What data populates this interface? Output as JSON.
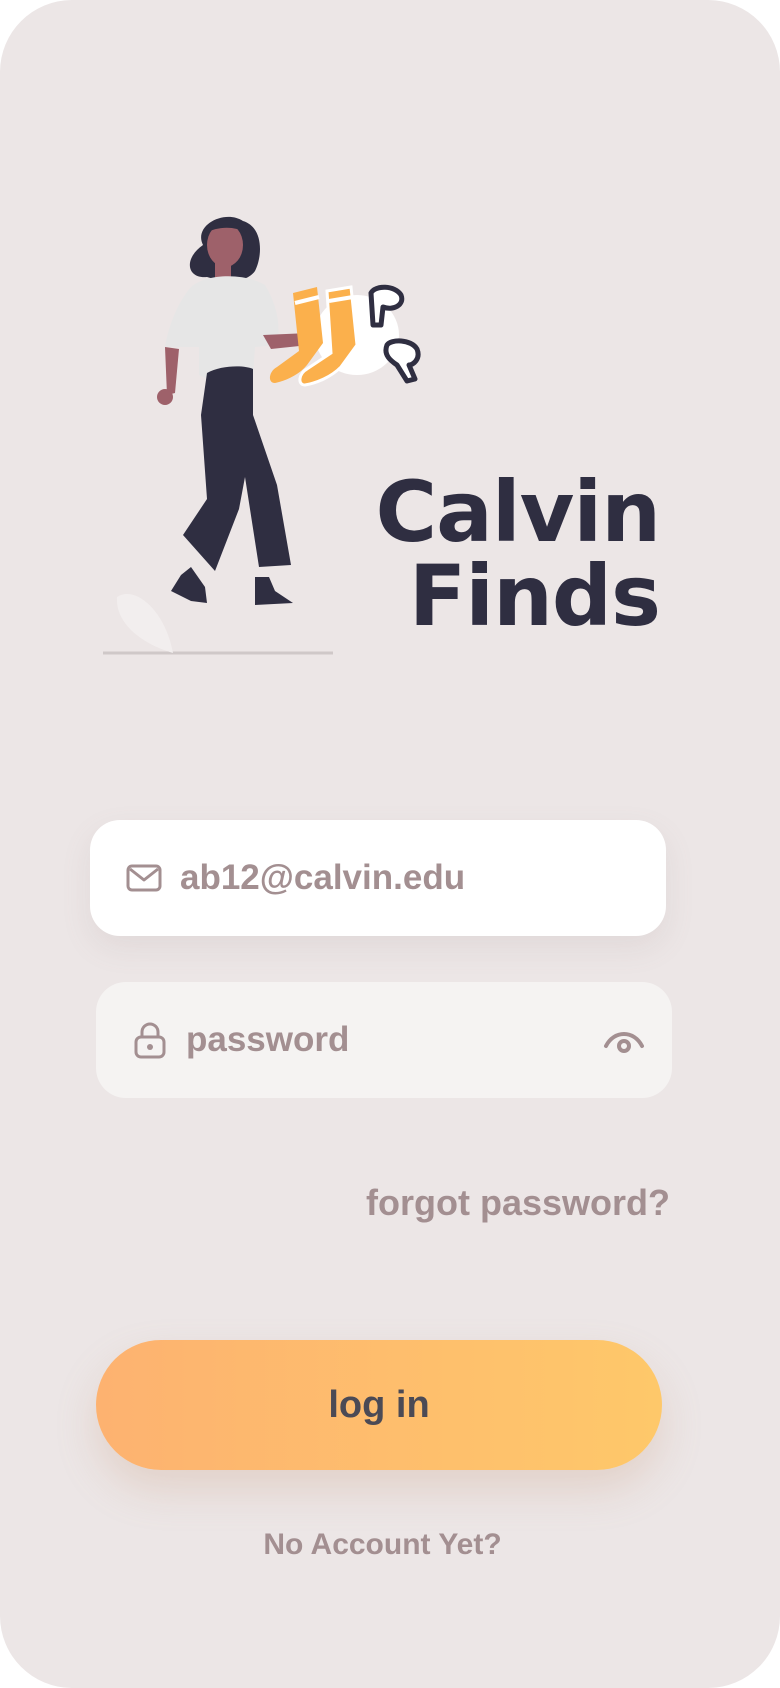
{
  "app": {
    "title_line1": "Calvin",
    "title_line2": "Finds"
  },
  "colors": {
    "background": "#ece6e6",
    "brand": "#2f2e41",
    "muted": "#a38f91",
    "accent_start": "#fdb270",
    "accent_end": "#fec86a"
  },
  "illustration": {
    "subject": "woman holding socks and earbuds"
  },
  "email": {
    "value": "ab12@calvin.edu",
    "icon": "mail-icon"
  },
  "password": {
    "placeholder": "password",
    "icon": "lock-icon",
    "toggle_icon": "eye-icon"
  },
  "links": {
    "forgot": "forgot password?",
    "signup": "No Account Yet?"
  },
  "login": {
    "label": "log in"
  }
}
